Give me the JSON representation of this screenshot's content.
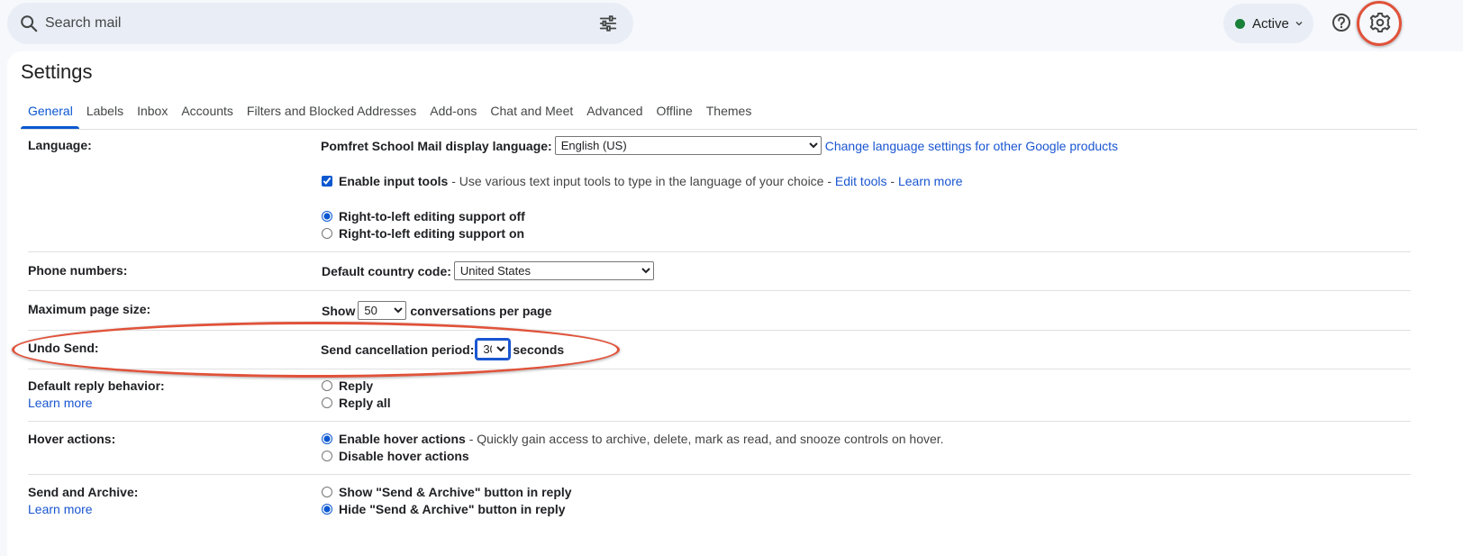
{
  "search": {
    "placeholder": "Search mail"
  },
  "status": {
    "label": "Active",
    "color": "#188038"
  },
  "accent": "#0b57d0",
  "highlight_color": "#e0523a",
  "settings": {
    "title": "Settings",
    "tabs": [
      {
        "label": "General",
        "active": true
      },
      {
        "label": "Labels"
      },
      {
        "label": "Inbox"
      },
      {
        "label": "Accounts"
      },
      {
        "label": "Filters and Blocked Addresses"
      },
      {
        "label": "Add-ons"
      },
      {
        "label": "Chat and Meet"
      },
      {
        "label": "Advanced"
      },
      {
        "label": "Offline"
      },
      {
        "label": "Themes"
      }
    ],
    "language": {
      "label": "Language:",
      "display_label": "Pomfret School Mail display language:",
      "display_value": "English (US)",
      "change_link": "Change language settings for other Google products",
      "input_tools_label": "Enable input tools",
      "input_tools_desc": " - Use various text input tools to type in the language of your choice - ",
      "edit_tools": "Edit tools",
      "dash": " - ",
      "learn_more": "Learn more",
      "rtl_off": "Right-to-left editing support off",
      "rtl_on": "Right-to-left editing support on"
    },
    "phone": {
      "label": "Phone numbers:",
      "country_label": "Default country code:",
      "country_value": "United States"
    },
    "page_size": {
      "label": "Maximum page size:",
      "show": "Show",
      "value": "50",
      "suffix": "conversations per page"
    },
    "undo_send": {
      "label": "Undo Send:",
      "period_label": "Send cancellation period:",
      "value": "30",
      "suffix": "seconds"
    },
    "reply": {
      "label": "Default reply behavior:",
      "learn_more": "Learn more",
      "reply": "Reply",
      "reply_all": "Reply all"
    },
    "hover": {
      "label": "Hover actions:",
      "enable": "Enable hover actions",
      "enable_desc": " - Quickly gain access to archive, delete, mark as read, and snooze controls on hover.",
      "disable": "Disable hover actions"
    },
    "send_archive": {
      "label": "Send and Archive:",
      "learn_more": "Learn more",
      "show": "Show \"Send & Archive\" button in reply",
      "hide": "Hide \"Send & Archive\" button in reply"
    }
  }
}
